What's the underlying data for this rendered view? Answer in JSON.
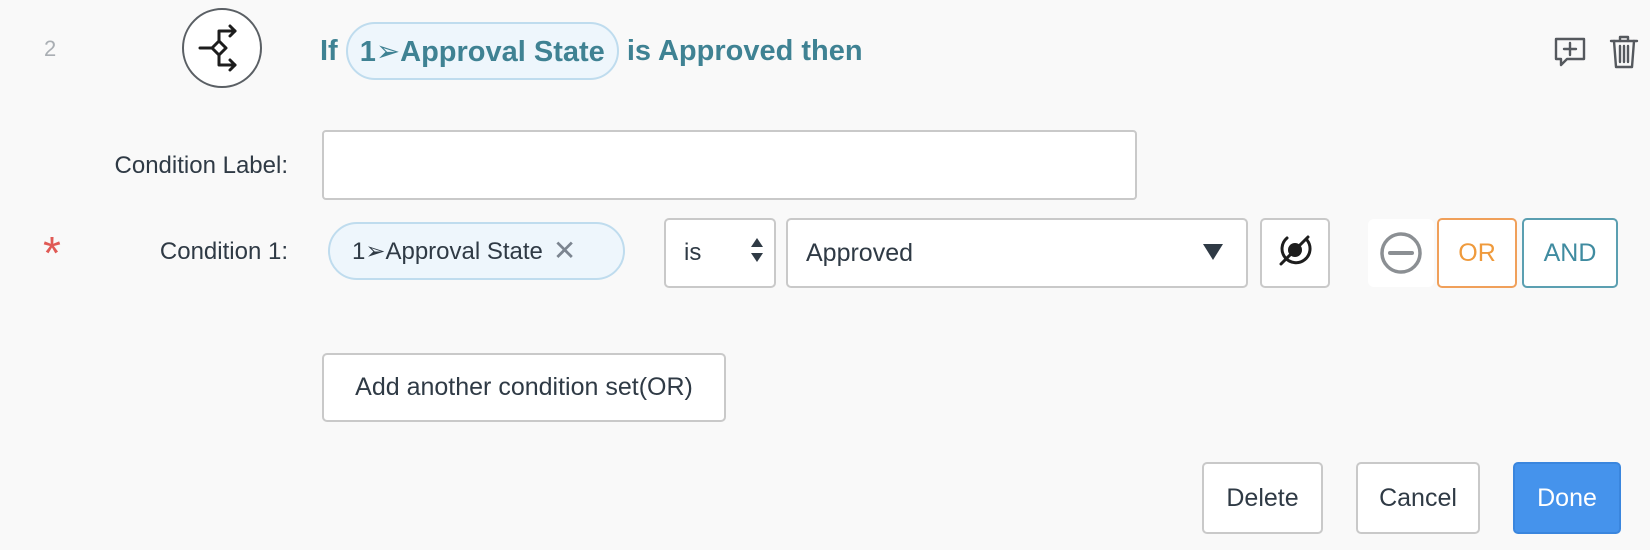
{
  "step": {
    "number": "2",
    "icon": "branch-decision-icon"
  },
  "header": {
    "prefix": "If",
    "field_pill": "1➢Approval State",
    "suffix": "is Approved then",
    "actions": {
      "comment_icon": "add-comment-icon",
      "delete_icon": "trash-icon"
    }
  },
  "form": {
    "condition_label": {
      "label": "Condition Label:",
      "value": "",
      "placeholder": ""
    },
    "condition_1": {
      "required_mark": "*",
      "label": "Condition 1:",
      "field_pill": "1➢Approval State",
      "operator": "is",
      "value": "Approved",
      "buttons": {
        "or": "OR",
        "and": "AND"
      }
    },
    "add_condition_set": "Add another condition set(OR)"
  },
  "footer": {
    "delete": "Delete",
    "cancel": "Cancel",
    "done": "Done"
  },
  "colors": {
    "accent_teal": "#3f8293",
    "or_orange": "#ef9a3c",
    "primary_blue": "#4593ec",
    "required_red": "#e05a55"
  }
}
